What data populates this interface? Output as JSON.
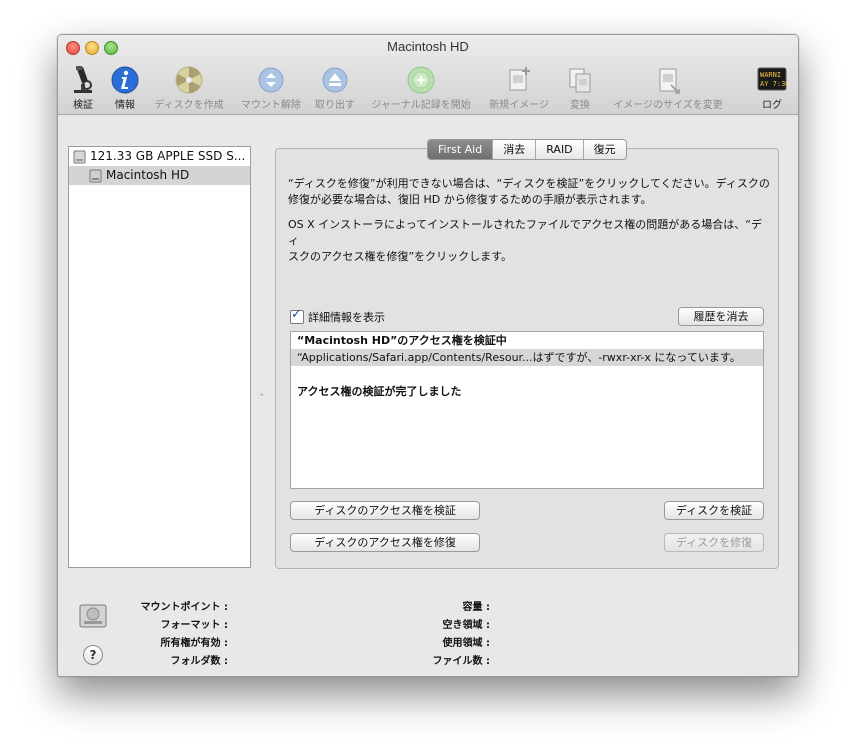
{
  "window": {
    "title": "Macintosh HD"
  },
  "toolbar": {
    "items": [
      {
        "label": "検証",
        "icon": "microscope-icon",
        "enabled": true
      },
      {
        "label": "情報",
        "icon": "info-icon",
        "enabled": true
      },
      {
        "label": "ディスクを作成",
        "icon": "burn-disc-icon",
        "enabled": false
      },
      {
        "label": "マウント解除",
        "icon": "unmount-icon",
        "enabled": false
      },
      {
        "label": "取り出す",
        "icon": "eject-icon",
        "enabled": false
      },
      {
        "label": "ジャーナル記録を開始",
        "icon": "journal-icon",
        "enabled": false
      },
      {
        "label": "新規イメージ",
        "icon": "new-image-icon",
        "enabled": false
      },
      {
        "label": "変換",
        "icon": "convert-icon",
        "enabled": false
      },
      {
        "label": "イメージのサイズを変更",
        "icon": "resize-image-icon",
        "enabled": false
      },
      {
        "label": "ログ",
        "icon": "log-console-icon",
        "enabled": true,
        "icon_text": "WARNI\nAY 7:36"
      }
    ]
  },
  "sidebar": {
    "disks": [
      {
        "label": "121.33 GB APPLE SSD S...",
        "selected": false,
        "icon": "hard-drive-icon"
      },
      {
        "label": "Macintosh HD",
        "selected": true,
        "icon": "volume-icon"
      }
    ]
  },
  "tabs": [
    {
      "label": "First Aid",
      "active": true
    },
    {
      "label": "消去",
      "active": false
    },
    {
      "label": "RAID",
      "active": false
    },
    {
      "label": "復元",
      "active": false
    }
  ],
  "first_aid": {
    "info_1_line1": "“ディスクを修復”が利用できない場合は、“ディスクを検証”をクリックしてください。ディスクの",
    "info_1_line2": "修復が必要な場合は、復旧 HD から修復するための手順が表示されます。",
    "info_2_line1": "OS X インストーラによってインストールされたファイルでアクセス権の問題がある場合は、“ディ",
    "info_2_line2": "スクのアクセス権を修復”をクリックします。",
    "show_details_label": "詳細情報を表示",
    "show_details_checked": true,
    "clear_history_label": "履歴を消去",
    "log_lines": [
      "“Macintosh HD”のアクセス権を検証中",
      "“Applications/Safari.app/Contents/Resour...はずですが、-rwxr-xr-x になっています。",
      "",
      "アクセス権の検証が完了しました"
    ],
    "verify_permissions_label": "ディスクのアクセス権を検証",
    "repair_permissions_label": "ディスクのアクセス権を修復",
    "verify_disk_label": "ディスクを検証",
    "repair_disk_label": "ディスクを修復"
  },
  "details": {
    "mount_point": "マウントポイント :",
    "format": "フォーマット :",
    "owners_enabled": "所有権が有効 :",
    "folder_count": "フォルダ数 :",
    "capacity": "容量 :",
    "available": "空き領域 :",
    "used": "使用領域 :",
    "file_count": "ファイル数 :",
    "help": "?"
  },
  "colors": {
    "accent": "#1f4ea8",
    "info_icon": "#2b6fd6",
    "disabled_text": "#8a8a8a"
  }
}
